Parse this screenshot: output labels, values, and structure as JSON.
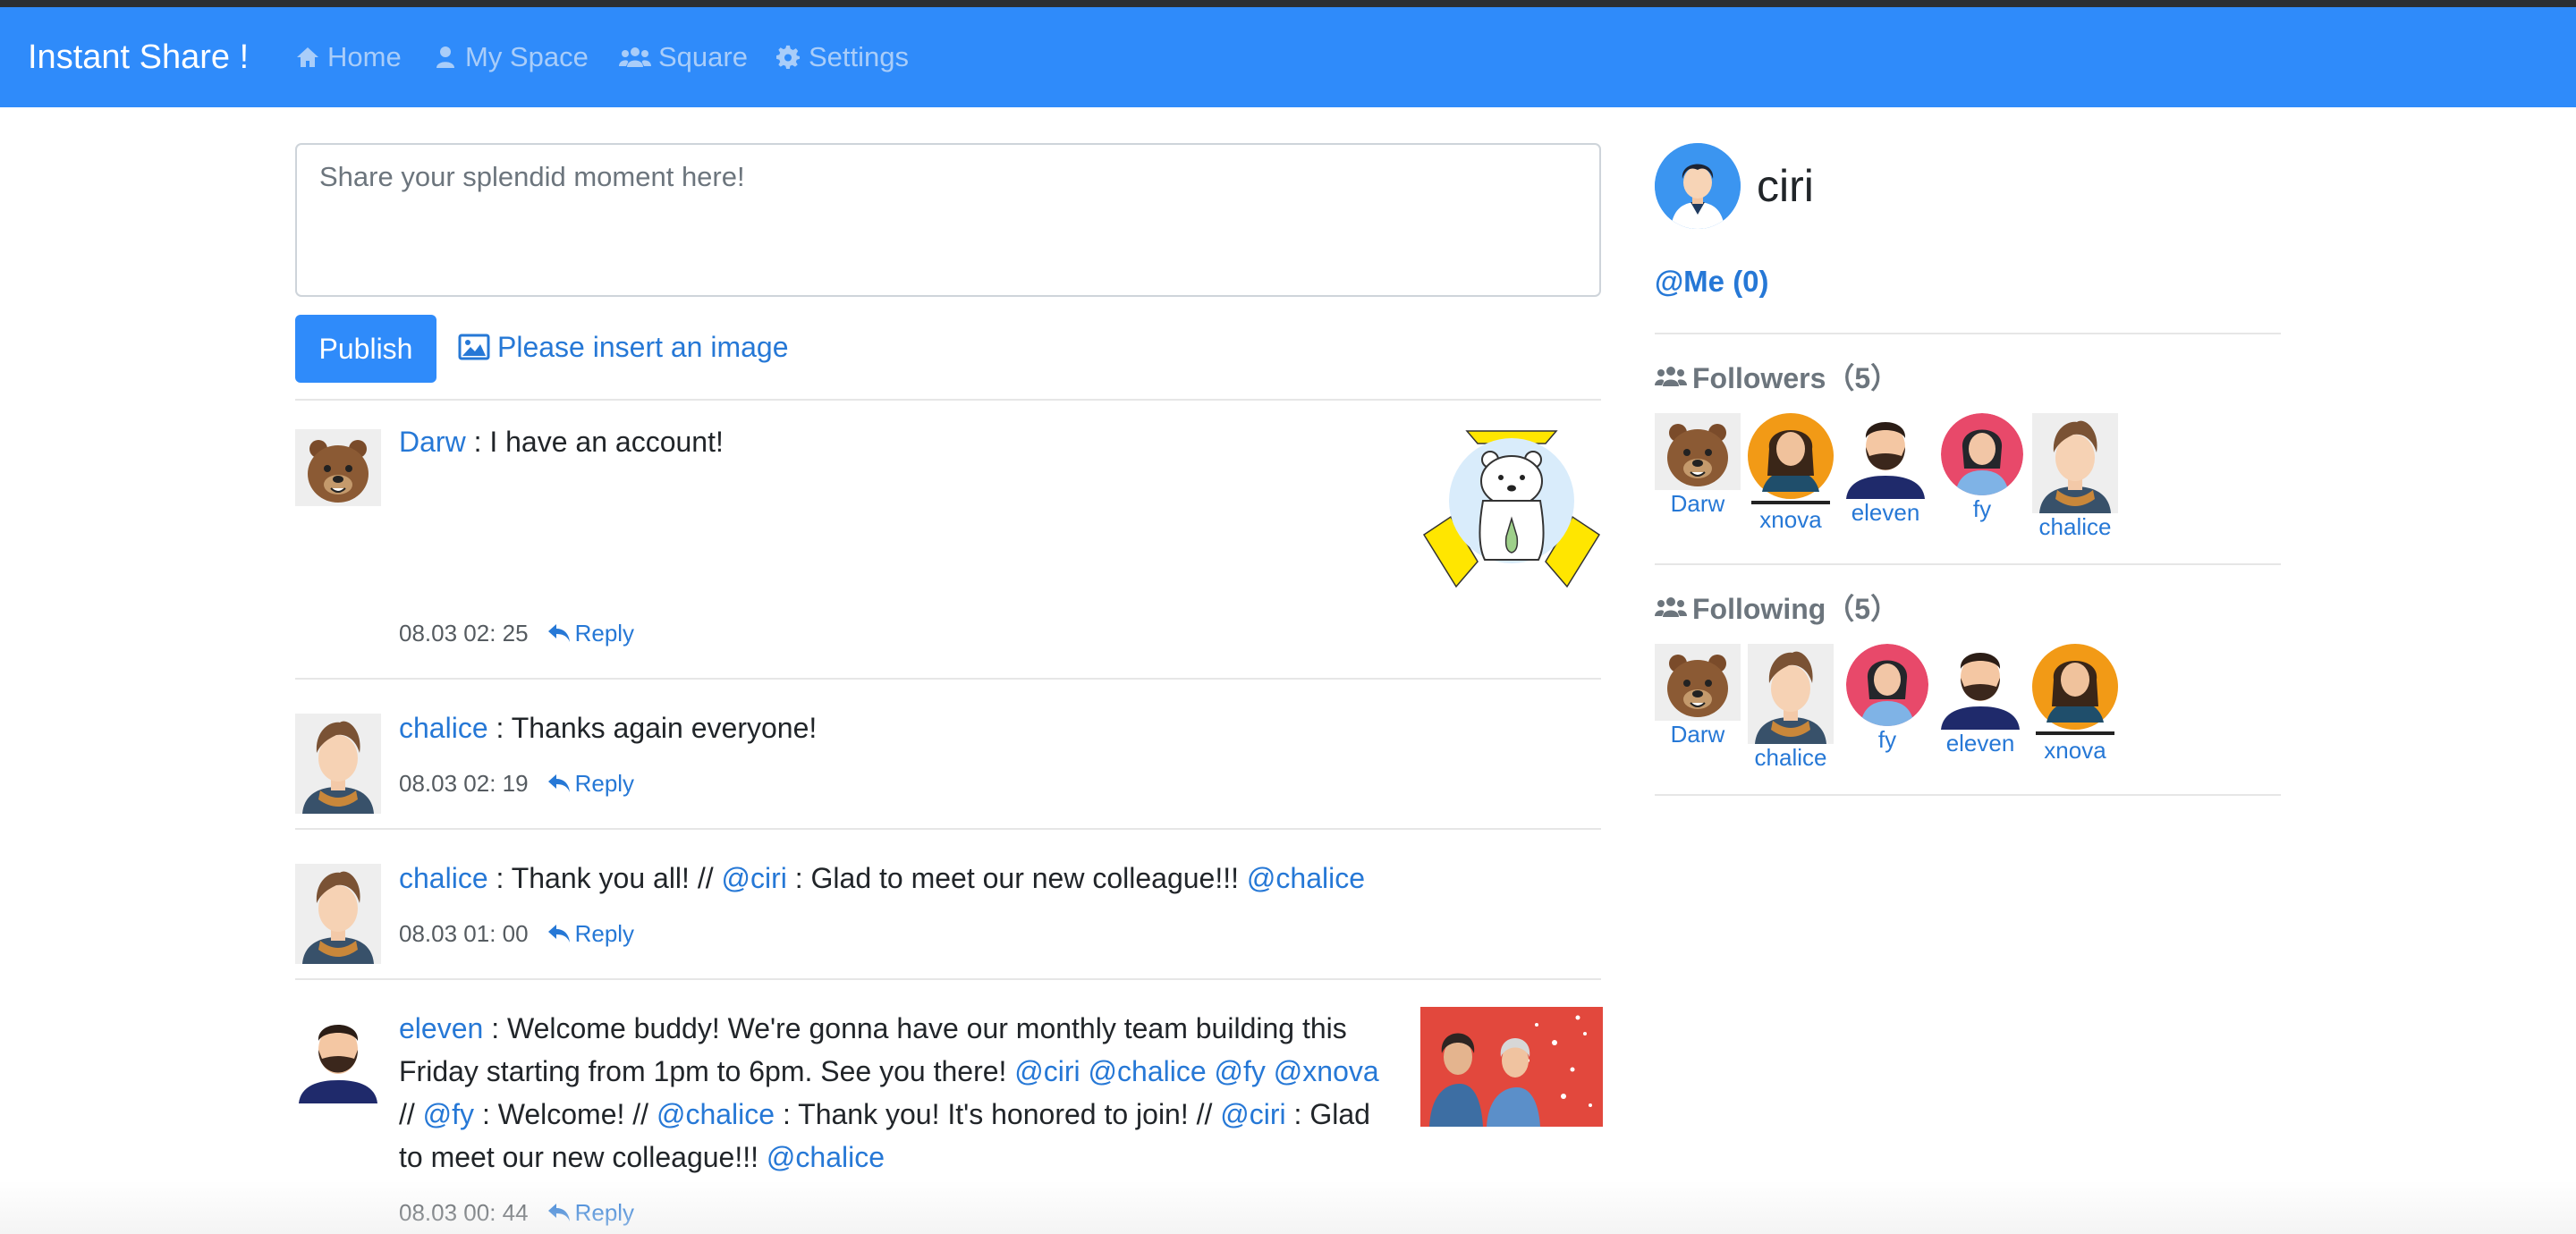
{
  "app": {
    "brand": "Instant Share !",
    "nav": [
      {
        "label": "Home",
        "icon": "home-icon"
      },
      {
        "label": "My Space",
        "icon": "user-icon"
      },
      {
        "label": "Square",
        "icon": "users-icon"
      },
      {
        "label": "Settings",
        "icon": "gear-icon"
      }
    ],
    "accent_color": "#2f8bfa",
    "link_color": "#2678d6"
  },
  "composer": {
    "placeholder": "Share your splendid moment here!",
    "value": "",
    "publish_label": "Publish",
    "insert_image_label": "Please insert an image"
  },
  "feed": {
    "reply_label": "Reply",
    "posts": [
      {
        "author": "Darw",
        "text": " : I have an account!",
        "time": "08.03 02: 25",
        "has_image": true,
        "image": "polar-bear-sticker"
      },
      {
        "author": "chalice",
        "text": " : Thanks again everyone!",
        "time": "08.03 02: 19",
        "has_image": false
      },
      {
        "author": "chalice",
        "segments": [
          {
            "t": " : Thank you all! // "
          },
          {
            "m": "@ciri"
          },
          {
            "t": " : Glad to meet our new colleague!!! "
          },
          {
            "m": "@chalice"
          }
        ],
        "time": "08.03 01: 00",
        "has_image": false
      },
      {
        "author": "eleven",
        "segments": [
          {
            "t": " : Welcome buddy! We're gonna have our monthly team building this Friday starting from 1pm to 6pm. See you there! "
          },
          {
            "m": "@ciri"
          },
          {
            "t": " "
          },
          {
            "m": "@chalice"
          },
          {
            "t": " "
          },
          {
            "m": "@fy"
          },
          {
            "t": " "
          },
          {
            "m": "@xnova"
          },
          {
            "t": " // "
          },
          {
            "m": "@fy"
          },
          {
            "t": " : Welcome! // "
          },
          {
            "m": "@chalice"
          },
          {
            "t": " : Thank you! It's honored to join! // "
          },
          {
            "m": "@ciri"
          },
          {
            "t": " : Glad to meet our new colleague!!! "
          },
          {
            "m": "@chalice"
          }
        ],
        "time": "08.03 00: 44",
        "has_image": true,
        "image": "party-photo"
      }
    ]
  },
  "profile": {
    "username": "ciri",
    "at_me_label": "@Me (0)",
    "followers_label": "Followers（5）",
    "following_label": "Following（5）",
    "followers": [
      "Darw",
      "xnova",
      "eleven",
      "fy",
      "chalice"
    ],
    "following": [
      "Darw",
      "chalice",
      "fy",
      "eleven",
      "xnova"
    ]
  }
}
